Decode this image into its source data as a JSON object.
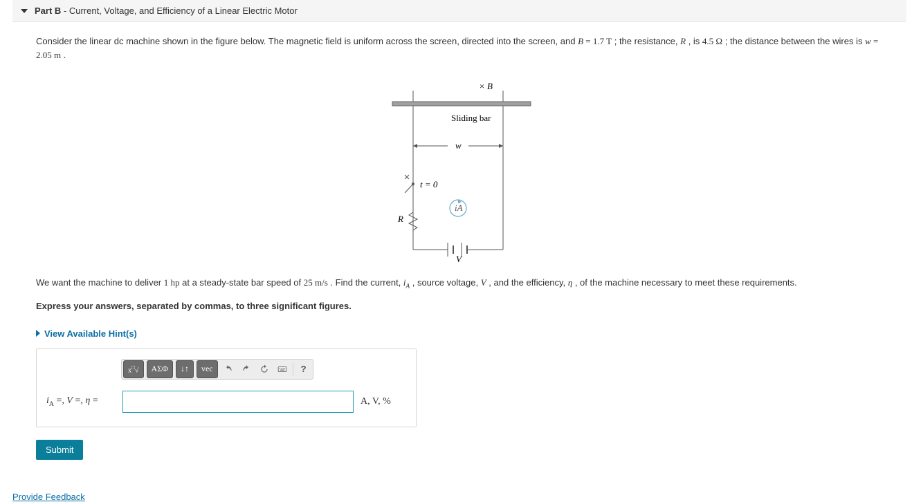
{
  "part": {
    "label": "Part B",
    "subtitle": " - Current, Voltage, and Efficiency of a Linear Electric Motor"
  },
  "prompt1_pre": "Consider the linear dc machine shown in the figure below. The magnetic field is uniform across the screen, directed into the screen, and ",
  "prompt1_B_lhs": "B",
  "prompt1_B_eq": " = ",
  "prompt1_B_val": "1.7 T",
  "prompt1_mid1": "; the resistance, ",
  "prompt1_R": "R",
  "prompt1_mid2": ", is ",
  "prompt1_R_val": "4.5 Ω",
  "prompt1_mid3": "; the distance between the wires is ",
  "prompt1_w_lhs": "w",
  "prompt1_w_eq": " = ",
  "prompt1_w_val": "2.05 m",
  "prompt1_end": ".",
  "figure": {
    "B_label": "× B",
    "sliding_bar": "Sliding bar",
    "w_label": "w",
    "t0_label": "t = 0",
    "R_label": "R",
    "iA_label": "iA",
    "V_label": "V"
  },
  "prompt2_pre": "We want the machine to deliver ",
  "prompt2_hp": "1 hp",
  "prompt2_mid1": " at a steady-state bar speed of ",
  "prompt2_speed": "25 m/s",
  "prompt2_mid2": ". Find the current, ",
  "prompt2_iA": "i",
  "prompt2_iA_sub": "A",
  "prompt2_mid3": ", source voltage, ",
  "prompt2_V": "V",
  "prompt2_mid4": ", and the efficiency, ",
  "prompt2_eta": "η",
  "prompt2_end": ", of the machine necessary to meet these requirements.",
  "instruct": "Express your answers, separated by commas, to three significant figures.",
  "hints_label": "View Available Hint(s)",
  "toolbar": {
    "templates": "▫√▫",
    "greek": "ΑΣΦ",
    "subsup": "↓↑",
    "vec": "vec",
    "help": "?"
  },
  "answer": {
    "lhs_iA": "i",
    "lhs_iA_sub": "A",
    "lhs_eq1": " =, ",
    "lhs_V": "V",
    "lhs_eq2": " =, ",
    "lhs_eta": "η",
    "lhs_eq3": " = ",
    "units": "A, V, %",
    "value": ""
  },
  "submit_label": "Submit",
  "feedback_label": "Provide Feedback"
}
